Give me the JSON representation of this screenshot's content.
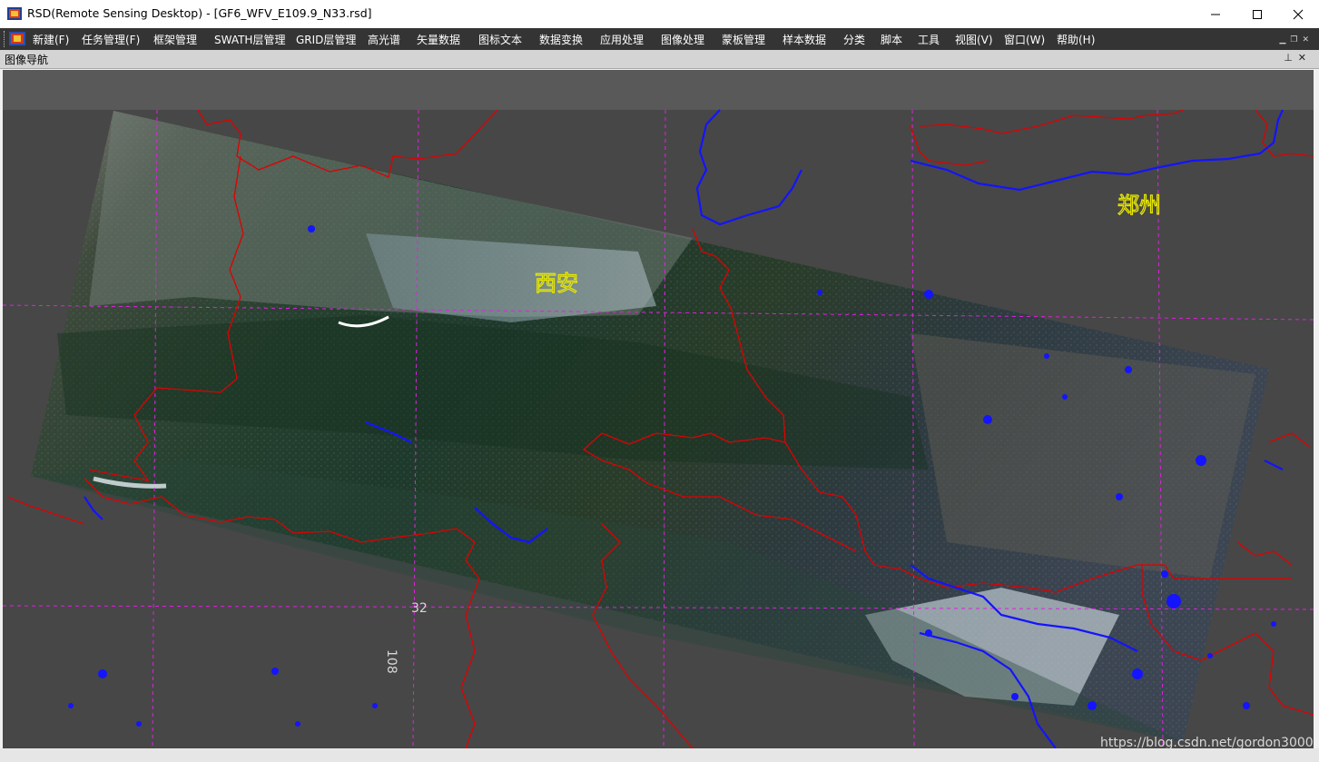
{
  "window": {
    "title": "RSD(Remote Sensing Desktop) - [GF6_WFV_E109.9_N33.rsd]"
  },
  "menu": {
    "items": [
      {
        "label": "新建(F)"
      },
      {
        "label": "任务管理(F)"
      },
      {
        "label": "框架管理"
      },
      {
        "label": "SWATH层管理"
      },
      {
        "label": "GRID层管理"
      },
      {
        "label": "高光谱"
      },
      {
        "label": "矢量数据"
      },
      {
        "label": "图标文本"
      },
      {
        "label": "数据变换"
      },
      {
        "label": "应用处理"
      },
      {
        "label": "图像处理"
      },
      {
        "label": "蒙板管理"
      },
      {
        "label": "样本数据"
      },
      {
        "label": "分类"
      },
      {
        "label": "脚本"
      },
      {
        "label": "工具"
      },
      {
        "label": "视图(V)"
      },
      {
        "label": "窗口(W)"
      },
      {
        "label": "帮助(H)"
      }
    ]
  },
  "panel": {
    "title": "图像导航"
  },
  "map": {
    "labels": {
      "city_east": "郑州",
      "city_center": "西安",
      "lat_label": "32",
      "lon_label": "108"
    },
    "colors": {
      "background": "#474747",
      "boundary": "#e00000",
      "grid": "#e020e0",
      "water": "#1414ff",
      "city_label": "#e8e800"
    }
  },
  "watermark": "https://blog.csdn.net/gordon3000"
}
